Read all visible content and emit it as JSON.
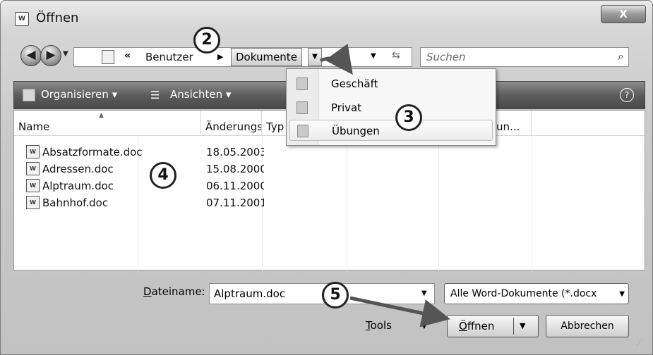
{
  "window": {
    "title": "Öffnen",
    "close_label": "X"
  },
  "nav": {
    "back_icon": "◀",
    "forward_icon": "▶",
    "breadcrumb": {
      "overflow": "«",
      "item1": "Benutzer",
      "item2": "Dokumente"
    },
    "search_placeholder": "Suchen"
  },
  "toolbar": {
    "organize": "Organisieren ▾",
    "views": "Ansichten ▾",
    "help": "?"
  },
  "columns": {
    "name": "Name",
    "date": "Änderungsdatum",
    "type": "Typ",
    "extra": "un..."
  },
  "files": [
    {
      "name": "Absatzformate.doc",
      "date": "18.05.2003"
    },
    {
      "name": "Adressen.doc",
      "date": "15.08.2000"
    },
    {
      "name": "Alptraum.doc",
      "date": "06.11.2000"
    },
    {
      "name": "Bahnhof.doc",
      "date": "07.11.2001"
    }
  ],
  "popup": {
    "items": [
      "Geschäft",
      "Privat",
      "Übungen"
    ],
    "selected": "Übungen"
  },
  "bottom": {
    "filename_label_first": "D",
    "filename_label_rest": "ateiname:",
    "filename_value": "Alptraum.doc",
    "filter": "Alle Word-Dokumente (*.docx",
    "tools_first": "T",
    "tools_rest": "ools",
    "open_first": "Ö",
    "open_rest": "ffnen",
    "cancel": "Abbrechen"
  },
  "callouts": [
    "2",
    "3",
    "4",
    "5"
  ],
  "icons": {
    "title": "word-doc-icon",
    "file": "word-doc-icon",
    "folder": "folder-icon",
    "search": "magnifier-icon",
    "refresh": "refresh-icon",
    "help": "help-icon"
  }
}
